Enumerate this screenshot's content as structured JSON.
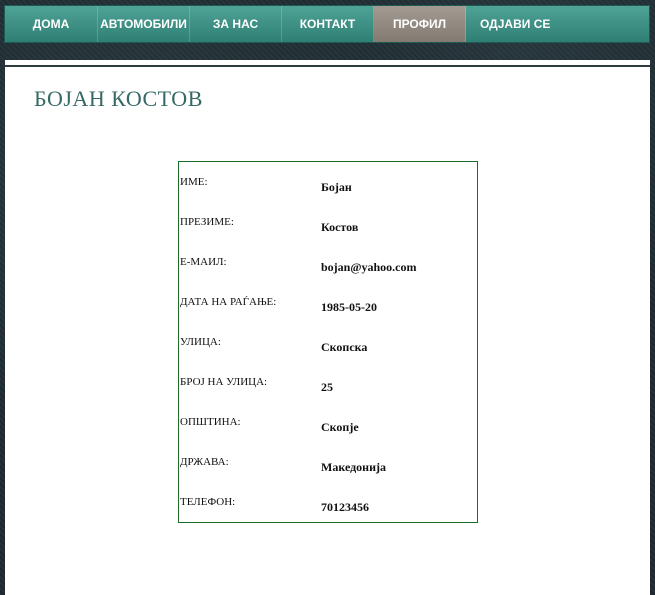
{
  "nav": {
    "items": [
      {
        "label": "ДОМА",
        "active": false
      },
      {
        "label": "АВТОМОБИЛИ",
        "active": false
      },
      {
        "label": "ЗА НАС",
        "active": false
      },
      {
        "label": "КОНТАКТ",
        "active": false
      },
      {
        "label": "ПРОФИЛ",
        "active": true
      },
      {
        "label": "ОДЈАВИ СЕ",
        "active": false
      }
    ]
  },
  "page": {
    "title": "БОЈАН КОСТОВ"
  },
  "profile": {
    "rows": [
      {
        "label": "ИМЕ:",
        "value": "Бојан"
      },
      {
        "label": "ПРЕЗИМЕ:",
        "value": "Костов"
      },
      {
        "label": "Е-МАИЛ:",
        "value": "bojan@yahoo.com"
      },
      {
        "label": "ДАТА НА РАЃАЊЕ:",
        "value": "1985-05-20"
      },
      {
        "label": "УЛИЦА:",
        "value": "Скопска"
      },
      {
        "label": "БРОЈ НА УЛИЦА:",
        "value": "25"
      },
      {
        "label": "ОПШТИНА:",
        "value": "Скопје"
      },
      {
        "label": "ДРЖАВА:",
        "value": "Македонија"
      },
      {
        "label": "ТЕЛЕФОН:",
        "value": "70123456"
      }
    ]
  },
  "colors": {
    "nav_bg": "#3f9184",
    "nav_active": "#938a82",
    "title": "#356a64",
    "box_border": "#1f6b28"
  }
}
